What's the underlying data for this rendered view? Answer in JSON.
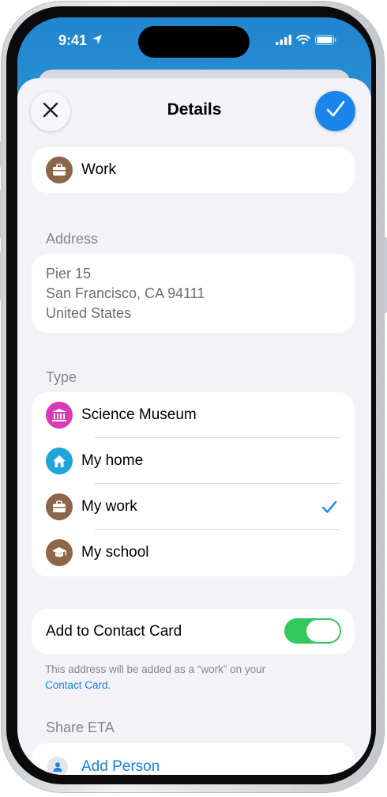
{
  "status_bar": {
    "time": "9:41"
  },
  "header": {
    "title": "Details"
  },
  "label_card": {
    "label": "Work"
  },
  "address": {
    "section_label": "Address",
    "lines": [
      "Pier 15",
      "San Francisco, CA  94111",
      "United States"
    ]
  },
  "type": {
    "section_label": "Type",
    "items": [
      {
        "label": "Science Museum",
        "icon": "museum-icon",
        "color": "#d93ab8"
      },
      {
        "label": "My home",
        "icon": "house-icon",
        "color": "#1fa6d9"
      },
      {
        "label": "My work",
        "icon": "briefcase-icon",
        "color": "#8d6548",
        "checked": true
      },
      {
        "label": "My school",
        "icon": "graduation-cap-icon",
        "color": "#8d6548"
      }
    ]
  },
  "contact_card": {
    "toggle_label": "Add to Contact Card",
    "toggle_on": true,
    "footnote_text": "This address will be added as a “work” on your",
    "footnote_link": "Contact Card."
  },
  "share_eta": {
    "section_label": "Share ETA",
    "add_person_label": "Add Person"
  },
  "colors": {
    "accent": "#1a86ec",
    "toggle_on": "#34c759",
    "sheet_bg": "#f2f2f7"
  }
}
